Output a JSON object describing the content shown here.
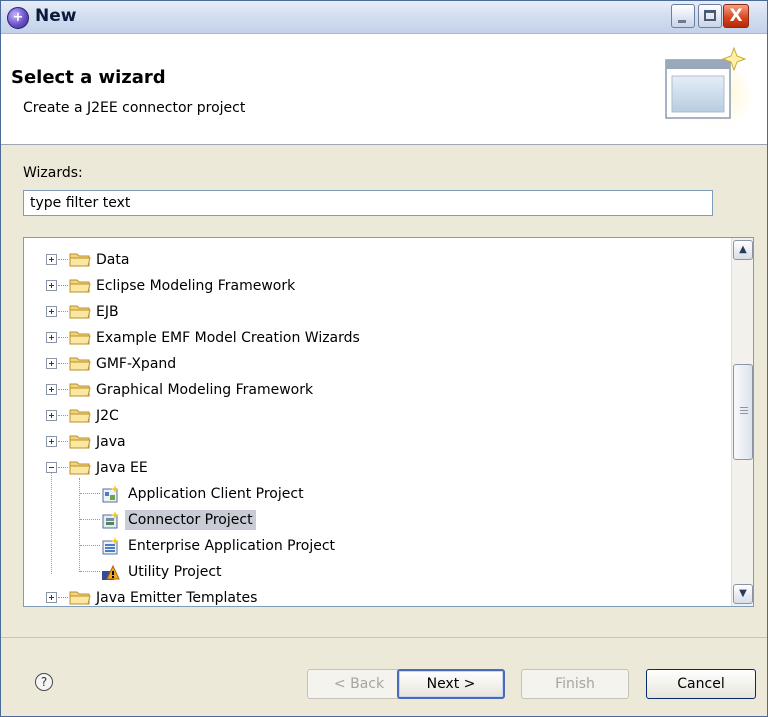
{
  "window": {
    "title": "New",
    "minimize_label": "_",
    "close_label": "X"
  },
  "header": {
    "title": "Select a wizard",
    "subtitle": "Create a J2EE connector project"
  },
  "filter": {
    "label": "Wizards:",
    "value": "type filter text"
  },
  "tree": {
    "items": [
      {
        "label": "Data",
        "type": "folder",
        "expanded": false
      },
      {
        "label": "Eclipse Modeling Framework",
        "type": "folder",
        "expanded": false
      },
      {
        "label": "EJB",
        "type": "folder",
        "expanded": false
      },
      {
        "label": "Example EMF Model Creation Wizards",
        "type": "folder",
        "expanded": false
      },
      {
        "label": "GMF-Xpand",
        "type": "folder",
        "expanded": false
      },
      {
        "label": "Graphical Modeling Framework",
        "type": "folder",
        "expanded": false
      },
      {
        "label": "J2C",
        "type": "folder",
        "expanded": false
      },
      {
        "label": "Java",
        "type": "folder",
        "expanded": false
      },
      {
        "label": "Java EE",
        "type": "folder",
        "expanded": true
      },
      {
        "label": "Application Client Project",
        "type": "project"
      },
      {
        "label": "Connector Project",
        "type": "project",
        "selected": true
      },
      {
        "label": "Enterprise Application Project",
        "type": "project"
      },
      {
        "label": "Utility Project",
        "type": "project"
      },
      {
        "label": "Java Emitter Templates",
        "type": "folder",
        "expanded": false
      }
    ],
    "selected": "Connector Project"
  },
  "scrollbar": {
    "up_glyph": "▲",
    "down_glyph": "▼"
  },
  "buttons": {
    "help_glyph": "?",
    "back": "< Back",
    "next": "Next >",
    "finish": "Finish",
    "cancel": "Cancel"
  },
  "colors": {
    "selection": "#c8ccd4",
    "folder": "#f2c14e",
    "title_bar": "#d3def0"
  }
}
